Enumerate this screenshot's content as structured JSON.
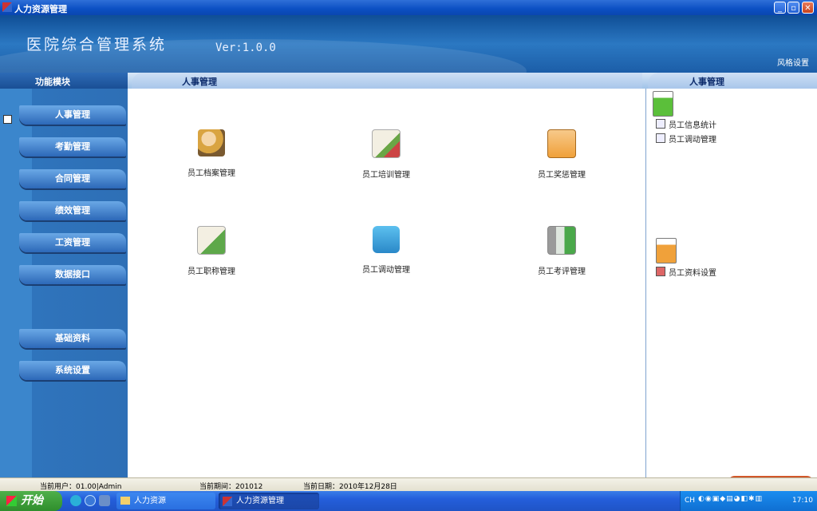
{
  "window": {
    "title": "人力资源管理",
    "min": "_",
    "max": "▫",
    "close": "✕"
  },
  "banner": {
    "system_name": "医院综合管理系统",
    "version": "Ver:1.0.0",
    "style_setting": "风格设置"
  },
  "section": {
    "left": "功能模块",
    "center": "人事管理",
    "right": "人事管理"
  },
  "sidebar": {
    "items": [
      {
        "label": "人事管理"
      },
      {
        "label": "考勤管理"
      },
      {
        "label": "合同管理"
      },
      {
        "label": "绩效管理"
      },
      {
        "label": "工资管理"
      },
      {
        "label": "数据接口"
      },
      {
        "label": "基础资料"
      },
      {
        "label": "系统设置"
      }
    ]
  },
  "main": {
    "tiles": [
      {
        "label": "员工档案管理",
        "icon": "person-briefcase-icon",
        "color": "#d9a441"
      },
      {
        "label": "员工培训管理",
        "icon": "certificate-icon",
        "color": "#c9a58c"
      },
      {
        "label": "员工奖惩管理",
        "icon": "clipboard-money-icon",
        "color": "#f0a13a"
      },
      {
        "label": "员工职称管理",
        "icon": "certificate-check-icon",
        "color": "#b8c58a"
      },
      {
        "label": "员工调动管理",
        "icon": "price-tag-icon",
        "color": "#3aa3d8"
      },
      {
        "label": "员工考评管理",
        "icon": "chart-refresh-icon",
        "color": "#7ab37a"
      }
    ]
  },
  "rpanel": {
    "group1": {
      "icon": "green-clipboard-icon",
      "links": [
        {
          "label": "员工信息统计"
        },
        {
          "label": "员工调动管理"
        }
      ]
    },
    "group2": {
      "icon": "orange-clipboard-icon",
      "links": [
        {
          "label": "员工资料设置"
        }
      ]
    }
  },
  "status": {
    "user": "当前用户：01.00|Admin",
    "period": "当前期间：201012",
    "date": "当前日期：2010年12月28日"
  },
  "taskbar": {
    "start": "开始",
    "tasks": [
      {
        "label": "人力资源"
      },
      {
        "label": "人力资源管理"
      }
    ],
    "ime": "中",
    "lang": "CH",
    "time": "17:10"
  }
}
